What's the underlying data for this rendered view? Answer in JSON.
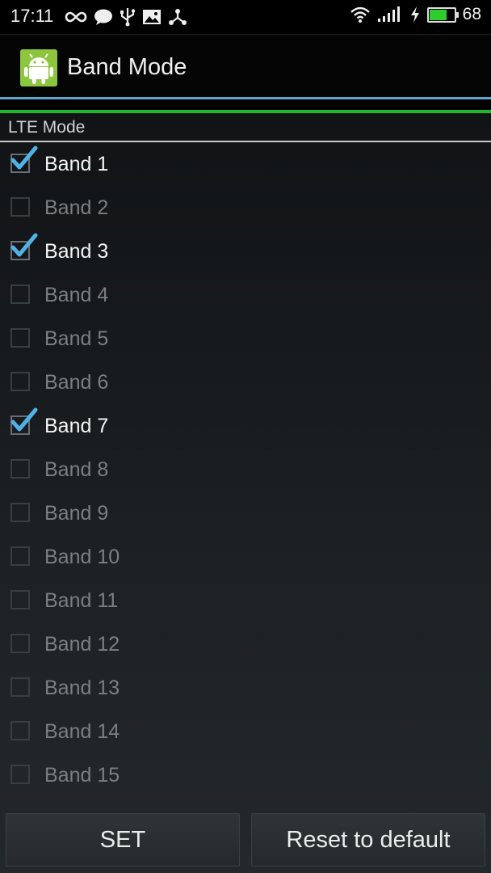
{
  "status_bar": {
    "time": "17:11",
    "battery_level": "68",
    "battery_fraction": 0.68,
    "left_icons": [
      "infinity-icon",
      "chat-bubble-icon",
      "usb-icon",
      "image-icon",
      "network-share-icon"
    ],
    "right_icons": [
      "wifi-icon",
      "signal-icon",
      "charging-bolt-icon",
      "battery-icon"
    ],
    "colors": {
      "battery_fill": "#2ecc2e"
    }
  },
  "action_bar": {
    "title": "Band Mode",
    "icon": "android-icon",
    "colors": {
      "icon_bg": "#8cc63f",
      "blue_line": "#5aa7cf",
      "green_line": "#20b62e"
    }
  },
  "section": {
    "title": "LTE Mode"
  },
  "bands": [
    {
      "label": "Band 1",
      "checked": true
    },
    {
      "label": "Band 2",
      "checked": false
    },
    {
      "label": "Band 3",
      "checked": true
    },
    {
      "label": "Band 4",
      "checked": false
    },
    {
      "label": "Band 5",
      "checked": false
    },
    {
      "label": "Band 6",
      "checked": false
    },
    {
      "label": "Band 7",
      "checked": true
    },
    {
      "label": "Band 8",
      "checked": false
    },
    {
      "label": "Band 9",
      "checked": false
    },
    {
      "label": "Band 10",
      "checked": false
    },
    {
      "label": "Band 11",
      "checked": false
    },
    {
      "label": "Band 12",
      "checked": false
    },
    {
      "label": "Band 13",
      "checked": false
    },
    {
      "label": "Band 14",
      "checked": false
    },
    {
      "label": "Band 15",
      "checked": false
    }
  ],
  "buttons": {
    "set_label": "SET",
    "reset_label": "Reset to default"
  },
  "accent_color": "#4fb3e6"
}
